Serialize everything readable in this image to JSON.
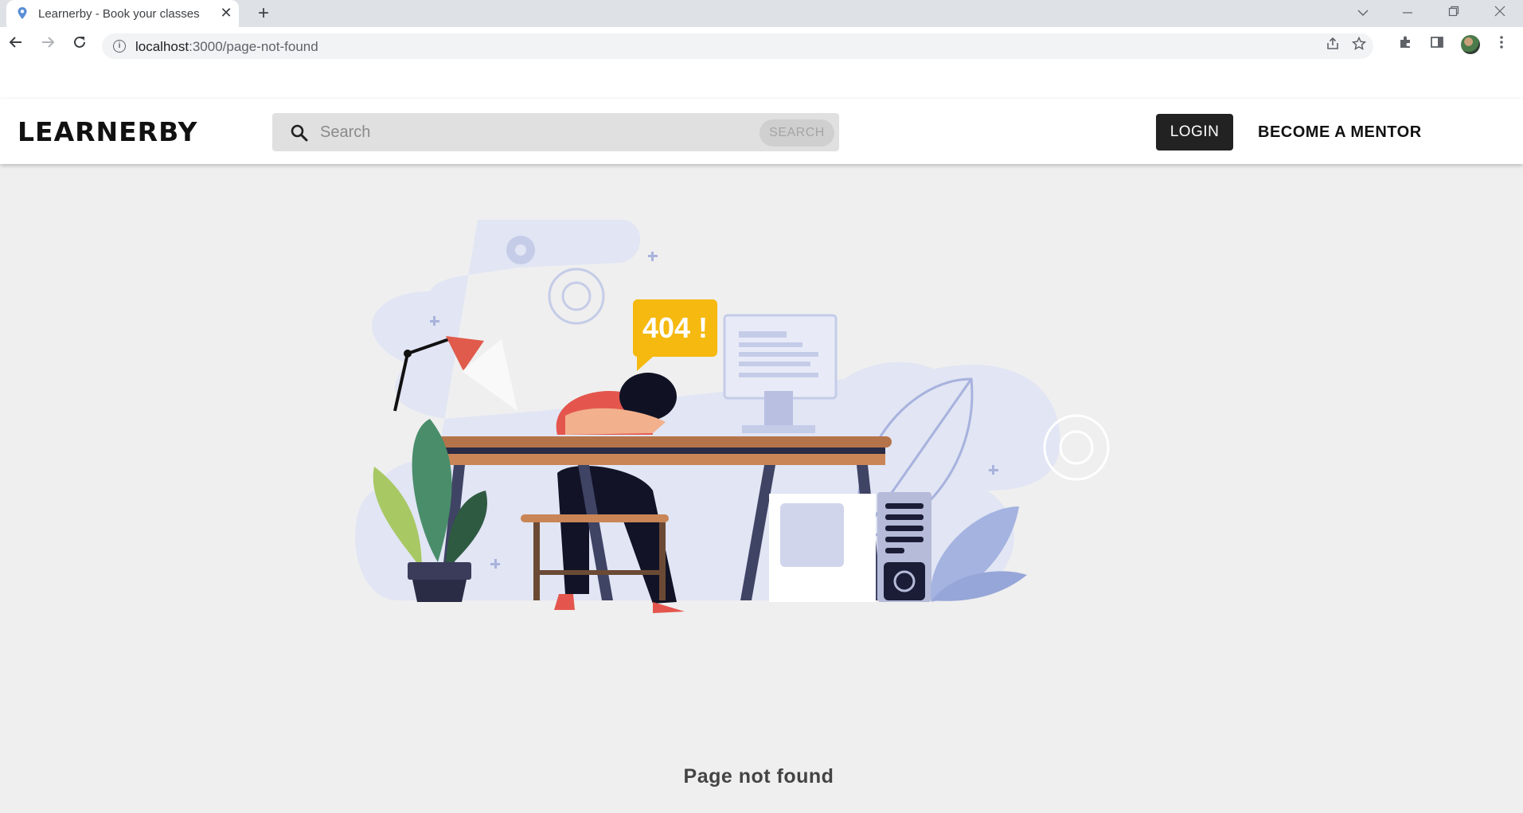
{
  "browser": {
    "tab": {
      "title": "Learnerby - Book your classes",
      "close_icon": "close-icon",
      "favicon": "map-pin-icon"
    },
    "new_tab_icon": "plus-icon",
    "window_controls": [
      "chevron-down-icon",
      "minimize-icon",
      "restore-icon",
      "close-icon"
    ],
    "url": {
      "host": "localhost",
      "path": ":3000/page-not-found"
    },
    "toolbar_icons": [
      "share-icon",
      "star-icon",
      "extensions-icon",
      "side-panel-icon",
      "profile-avatar",
      "more-vert-icon"
    ]
  },
  "header": {
    "logo": "LEARNERBY",
    "search": {
      "placeholder": "Search",
      "value": "",
      "button_label": "SEARCH"
    },
    "login_label": "LOGIN",
    "mentor_label": "BECOME A MENTOR"
  },
  "main": {
    "badge_text": "404 !",
    "message": "Page not found"
  },
  "colors": {
    "accent_dark": "#222222",
    "badge_yellow": "#f5b90f",
    "blob": "#e1e5f4",
    "desk_brown": "#b5734a"
  }
}
